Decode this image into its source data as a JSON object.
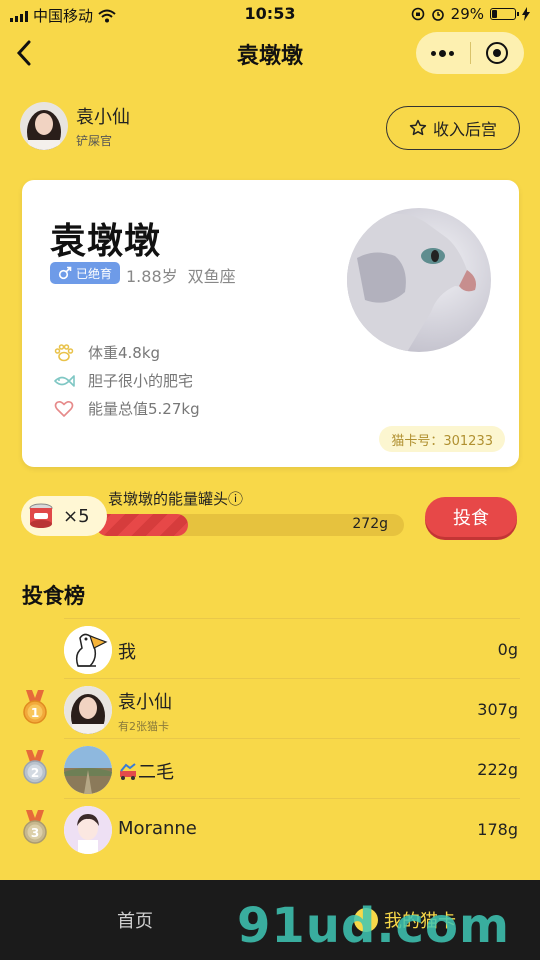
{
  "status": {
    "carrier": "中国移动",
    "time": "10:53",
    "battery": "29%",
    "battery_level": 0.29
  },
  "nav": {
    "title": "袁墩墩"
  },
  "owner": {
    "name": "袁小仙",
    "role": "铲屎官",
    "collect_label": "收入后宫"
  },
  "cat": {
    "name": "袁墩墩",
    "neuter_badge": "已绝育",
    "age": "1.88岁",
    "zodiac": "双鱼座",
    "weight": "体重4.8kg",
    "personality": "胆子很小的肥宅",
    "energy_total": "能量总值5.27kg",
    "card_no": "猫卡号：301233"
  },
  "energy": {
    "label": "袁墩墩的能量罐头ⓘ",
    "can_count": "×5",
    "value": "272g",
    "progress": 0.3,
    "feed_label": "投食"
  },
  "leaderboard": {
    "title": "投食榜",
    "rows": [
      {
        "name": "我",
        "sub": "",
        "value": "0g",
        "rank": ""
      },
      {
        "name": "袁小仙",
        "sub": "有2张猫卡",
        "value": "307g",
        "rank": "1"
      },
      {
        "name": "二毛",
        "sub": "",
        "value": "222g",
        "rank": "2"
      },
      {
        "name": "Moranne",
        "sub": "",
        "value": "178g",
        "rank": "3"
      }
    ]
  },
  "tabs": {
    "home": "首页",
    "my_cards": "我的猫卡"
  },
  "watermark": "91ud.com",
  "colors": {
    "background": "#F8D849",
    "accent_red": "#E74848",
    "tab_bg": "#1b1b1b"
  }
}
